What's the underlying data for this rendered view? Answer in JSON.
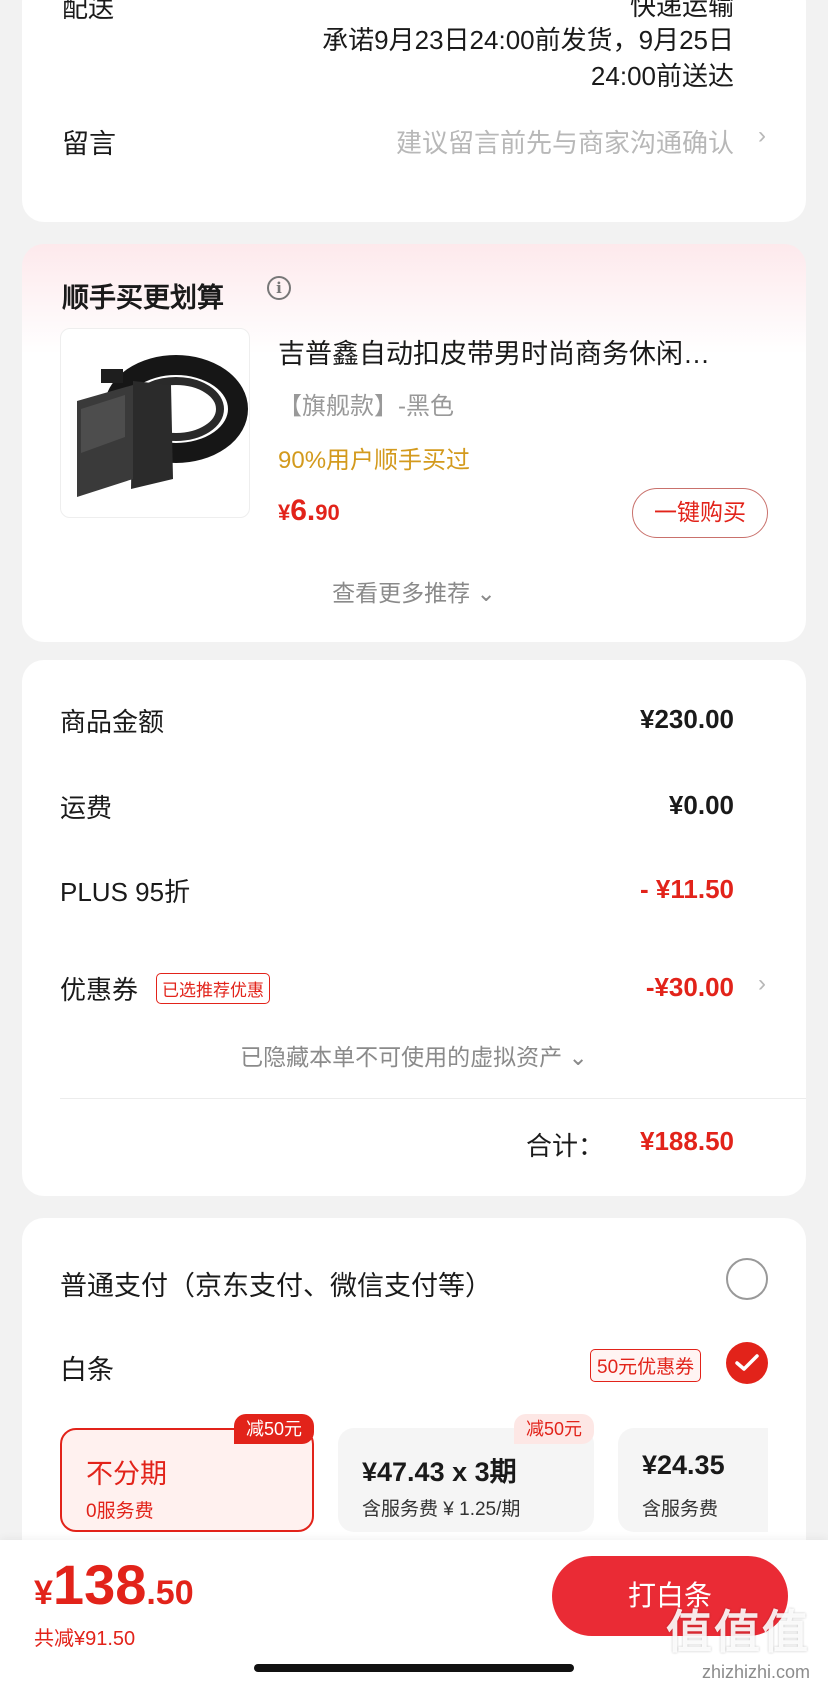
{
  "delivery": {
    "label": "配送",
    "method": "快递运输",
    "promise": "承诺9月23日24:00前发货，9月25日24:00前送达"
  },
  "message": {
    "label": "留言",
    "placeholder": "建议留言前先与商家沟通确认"
  },
  "recommend": {
    "title": "顺手买更划算",
    "product_name": "吉普鑫自动扣皮带男时尚商务休闲…",
    "spec": "【旗舰款】-黑色",
    "tip": "90%用户顺手买过",
    "price_currency": "¥",
    "price_int": "6.",
    "price_dec": "90",
    "buy_label": "一键购买",
    "see_more": "查看更多推荐"
  },
  "price": {
    "rows": [
      {
        "label": "商品金额",
        "value": "¥230.00"
      },
      {
        "label": "运费",
        "value": "¥0.00"
      },
      {
        "label": "PLUS 95折",
        "value": "- ¥11.50"
      },
      {
        "label": "优惠券",
        "value": "-¥30.00"
      }
    ],
    "coupon_badge": "已选推荐优惠",
    "hidden_assets": "已隐藏本单不可使用的虚拟资产",
    "total_label": "合计：",
    "total_value": "¥188.50"
  },
  "payment": {
    "normal_label": "普通支付（京东支付、微信支付等）",
    "baitiao_label": "白条",
    "baitiao_badge": "50元优惠券",
    "plans": [
      {
        "tag": "减50元",
        "main": "不分期",
        "sub": "0服务费",
        "selected": true
      },
      {
        "tag": "减50元",
        "main": "¥47.43 x 3期",
        "sub": "含服务费 ¥ 1.25/期",
        "selected": false
      },
      {
        "tag": "",
        "main": "¥24.35",
        "sub": "含服务费",
        "selected": false
      }
    ]
  },
  "bottom": {
    "currency": "¥",
    "amount_int": "138",
    "amount_dec": ".50",
    "saved": "共减¥91.50",
    "pay_button": "打白条"
  },
  "watermark": {
    "big": "值值值",
    "small": "zhizhizhi.com"
  },
  "colors": {
    "accent": "#e2231a",
    "button": "#ea2b35",
    "tip_gold": "#d39a1d"
  }
}
